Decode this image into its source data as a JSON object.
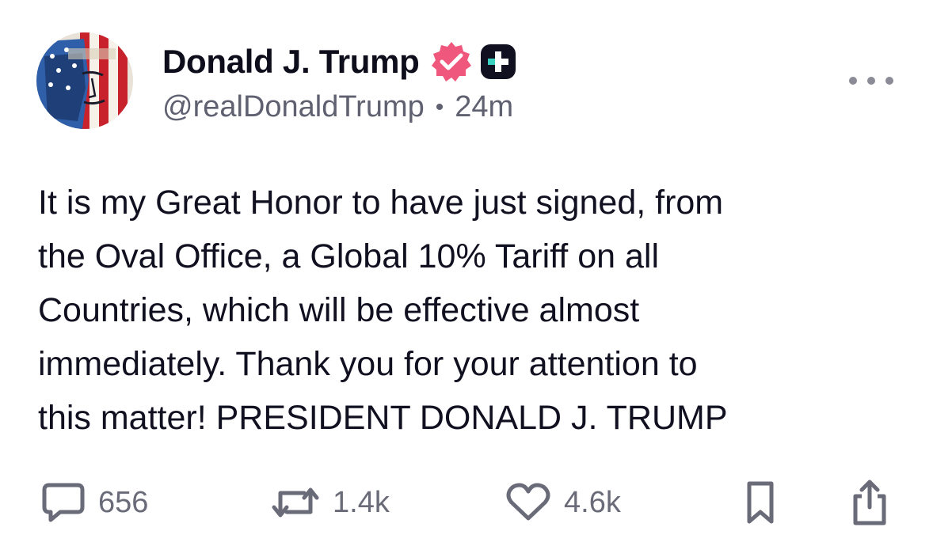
{
  "author": {
    "display_name": "Donald J. Trump",
    "handle": "@realDonaldTrump",
    "separator": "•",
    "timestamp": "24m",
    "verified_badge_color": "#f0577c",
    "plus_badge_color": "#111020"
  },
  "post": {
    "lines": [
      "It is my Great Honor to have just signed, from",
      "the Oval Office, a Global 10% Tariff on all",
      "Countries, which will be effective almost",
      "immediately. Thank you for your attention to",
      "this matter! PRESIDENT DONALD J. TRUMP"
    ]
  },
  "actions": {
    "replies": {
      "icon": "reply-bubble-icon",
      "count": "656"
    },
    "retruths": {
      "icon": "repost-arrows-icon",
      "count": "1.4k"
    },
    "likes": {
      "icon": "heart-icon",
      "count": "4.6k"
    },
    "bookmark": {
      "icon": "bookmark-icon"
    },
    "share": {
      "icon": "share-icon"
    }
  },
  "more_menu": {
    "icon": "more-horizontal-icon"
  },
  "colors": {
    "text_primary": "#111020",
    "text_secondary": "#5f6070",
    "icon_gray": "#6a6b78"
  }
}
